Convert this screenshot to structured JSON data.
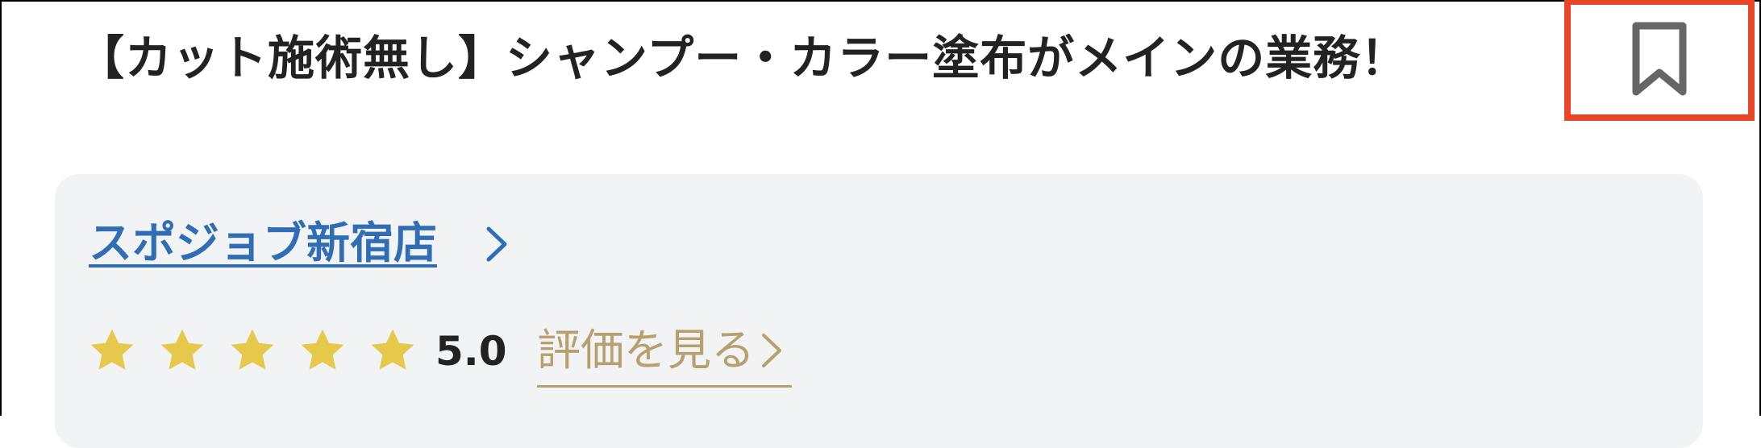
{
  "job": {
    "title": "【カット施術無し】シャンプー・カラー塗布がメインの業務！"
  },
  "bookmark": {
    "icon": "bookmark-icon",
    "highlight_color": "#e94526"
  },
  "store": {
    "name": "スポジョブ新宿店",
    "link_color": "#2f6db5"
  },
  "rating": {
    "value": "5.0",
    "stars_filled": 5,
    "stars_total": 5,
    "star_color": "#e6c84a",
    "review_link_label": "評価を見る",
    "review_link_color": "#b79f6e"
  }
}
